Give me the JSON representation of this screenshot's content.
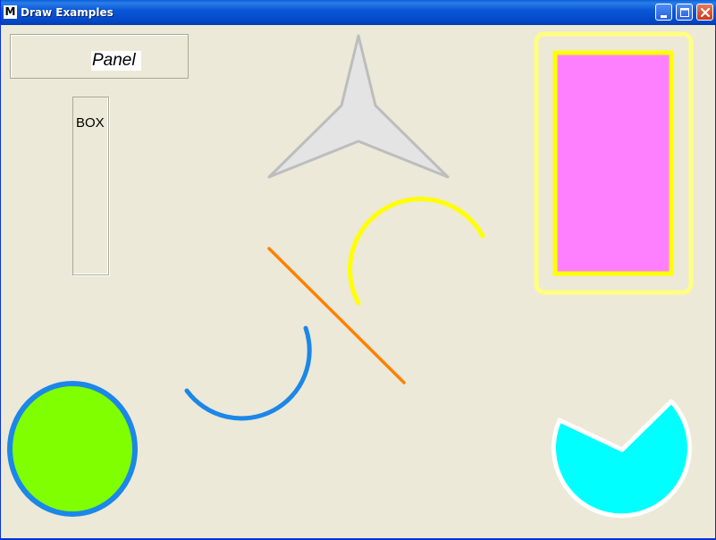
{
  "window": {
    "title": "Draw Examples",
    "app_icon_letter": "M",
    "buttons": [
      "minimize",
      "maximize",
      "close"
    ]
  },
  "panel": {
    "label": "Panel"
  },
  "box": {
    "label": "BOX"
  },
  "shapes": {
    "star": {
      "fill": "#e4e4e4",
      "stroke": "#bdbdbd"
    },
    "rect": {
      "fill": "#ff80ff",
      "stroke": "#ffff00",
      "outer_stroke": "#ffff80"
    },
    "yellow_arc": {
      "stroke": "#ffff00"
    },
    "orange_line": {
      "stroke": "#ff8000"
    },
    "blue_arc": {
      "stroke": "#1b87e8"
    },
    "green_circle": {
      "fill": "#80ff00",
      "stroke": "#1b87e8"
    },
    "cyan_pie": {
      "fill": "#00ffff",
      "stroke": "#ffffff"
    }
  }
}
